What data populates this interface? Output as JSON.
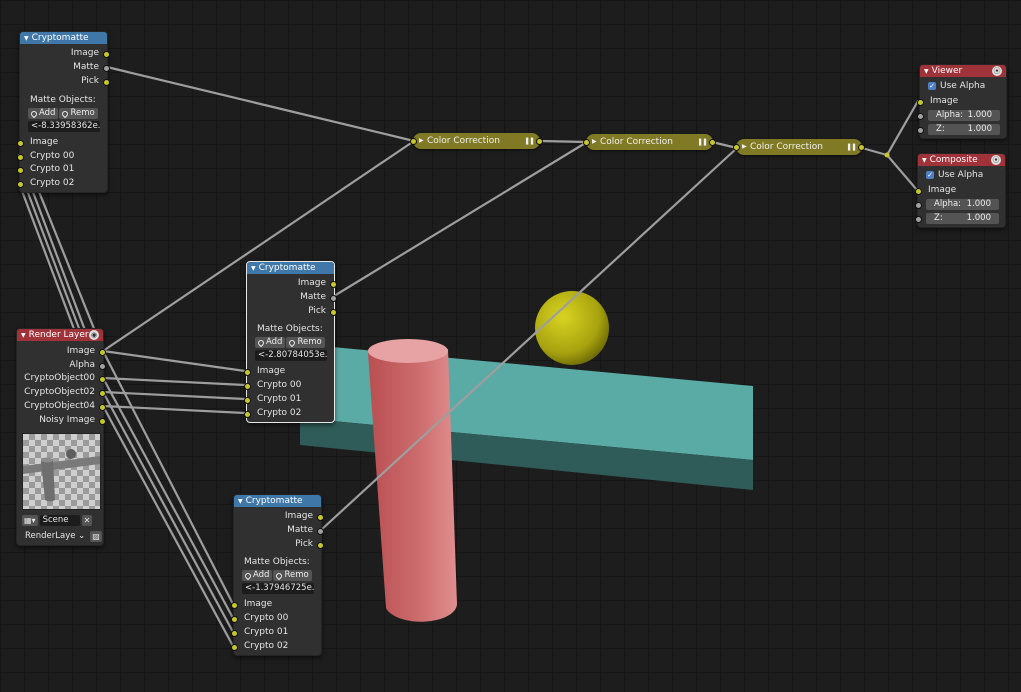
{
  "crypto_top": {
    "title": "Cryptomatte",
    "outputs": [
      "Image",
      "Matte",
      "Pick"
    ],
    "section_label": "Matte Objects:",
    "add_label": "Add",
    "remove_label": "Remo",
    "matte_value": "<-8.33958362e..",
    "inputs": [
      "Image",
      "Crypto 00",
      "Crypto 01",
      "Crypto 02"
    ]
  },
  "crypto_mid": {
    "title": "Cryptomatte",
    "outputs": [
      "Image",
      "Matte",
      "Pick"
    ],
    "section_label": "Matte Objects:",
    "add_label": "Add",
    "remove_label": "Remo",
    "matte_value": "<-2.80784053e..",
    "inputs": [
      "Image",
      "Crypto 00",
      "Crypto 01",
      "Crypto 02"
    ]
  },
  "crypto_bottom": {
    "title": "Cryptomatte",
    "outputs": [
      "Image",
      "Matte",
      "Pick"
    ],
    "section_label": "Matte Objects:",
    "add_label": "Add",
    "remove_label": "Remo",
    "matte_value": "<-1.37946725e..",
    "inputs": [
      "Image",
      "Crypto 00",
      "Crypto 01",
      "Crypto 02"
    ]
  },
  "render_layer": {
    "title": "Render Layer",
    "outputs": [
      "Image",
      "Alpha",
      "CryptoObject00",
      "CryptoObject02",
      "CryptoObject04",
      "Noisy Image"
    ],
    "scene_label": "Scene",
    "layer_label": "RenderLaye"
  },
  "color_correction": {
    "nodes": [
      "Color Correction",
      "Color Correction",
      "Color Correction"
    ]
  },
  "viewer": {
    "title": "Viewer",
    "use_alpha_label": "Use Alpha",
    "input_label": "Image",
    "alpha_label": "Alpha:",
    "alpha_value": "1.000",
    "z_label": "Z:",
    "z_value": "1.000"
  },
  "composite": {
    "title": "Composite",
    "use_alpha_label": "Use Alpha",
    "input_label": "Image",
    "alpha_label": "Alpha:",
    "alpha_value": "1.000",
    "z_label": "Z:",
    "z_value": "1.000"
  },
  "colors": {
    "socket_color": "#c7c729",
    "color_correction_header": "#817a25",
    "cryptomatte_header": "#3f78a8",
    "output_header": "#a0333a",
    "link_color": "#9e9e9e",
    "backdrop_plane": "#57a8a3",
    "backdrop_cylinder": "#cc6b6c",
    "backdrop_sphere": "#b8b313"
  }
}
